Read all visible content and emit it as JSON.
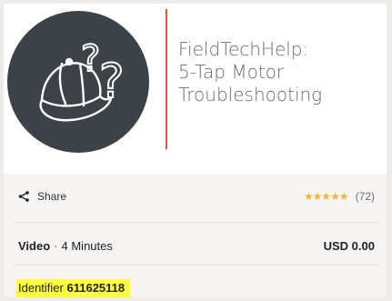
{
  "course": {
    "title_lines": [
      "FieldTechHelp:",
      "5-Tap Motor",
      "Troubleshooting"
    ]
  },
  "share": {
    "label": "Share",
    "icon": "share-icon"
  },
  "rating": {
    "stars": "★★★★★",
    "count": "(72)",
    "value": 5,
    "max": 5
  },
  "meta": {
    "type": "Video",
    "separator": "·",
    "duration": "4 Minutes",
    "price": "USD 0.00"
  },
  "identifier": {
    "label": "Identifier",
    "value": "611625118"
  },
  "colors": {
    "accent": "#e8553a",
    "logo_bg": "#3d4249",
    "star": "#f2b632",
    "highlight": "#ffff3a"
  }
}
